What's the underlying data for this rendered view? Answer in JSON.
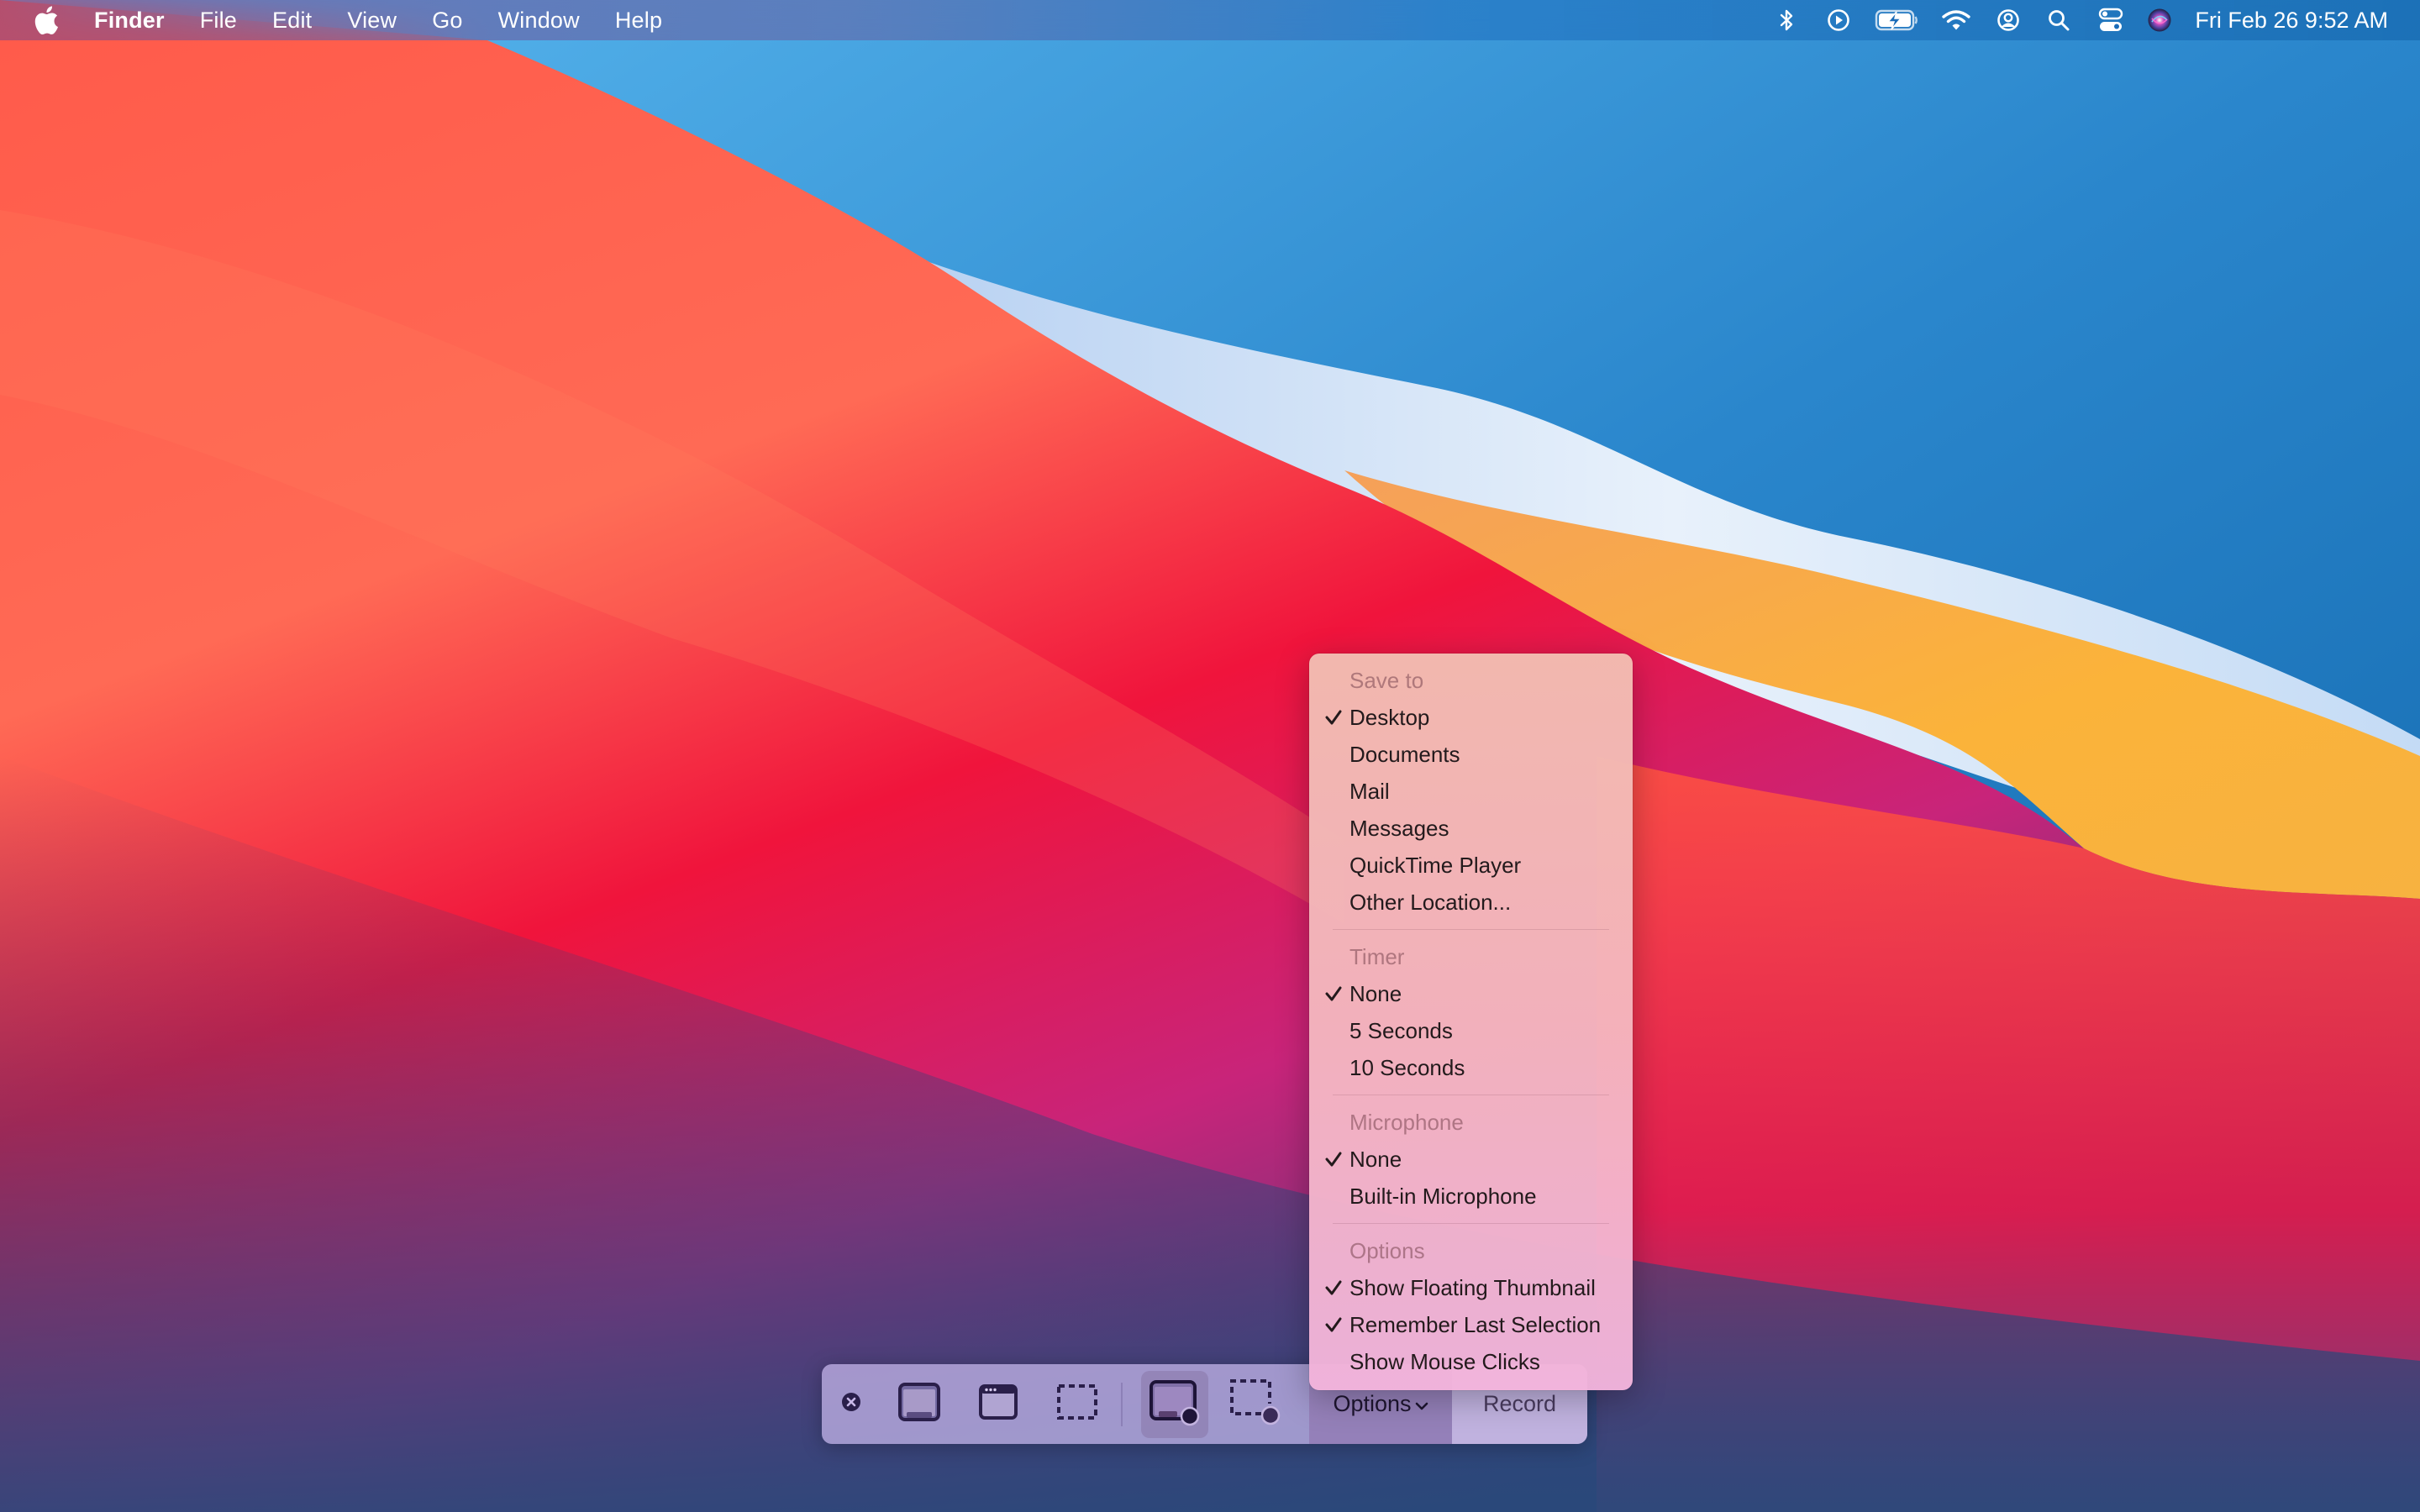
{
  "menubar": {
    "apple_icon": "apple-logo-icon",
    "app_name": "Finder",
    "menus": [
      "File",
      "Edit",
      "View",
      "Go",
      "Window",
      "Help"
    ],
    "status_icons": [
      "bluetooth-icon",
      "screen-recording-icon",
      "battery-charging-icon",
      "wifi-icon",
      "user-account-icon",
      "spotlight-search-icon",
      "control-center-icon",
      "siri-icon"
    ],
    "clock": "Fri Feb 26  9:52 AM"
  },
  "options_menu": {
    "sections": [
      {
        "title": "Save to",
        "items": [
          {
            "label": "Desktop",
            "checked": true
          },
          {
            "label": "Documents",
            "checked": false
          },
          {
            "label": "Mail",
            "checked": false
          },
          {
            "label": "Messages",
            "checked": false
          },
          {
            "label": "QuickTime Player",
            "checked": false
          },
          {
            "label": "Other Location...",
            "checked": false
          }
        ]
      },
      {
        "title": "Timer",
        "items": [
          {
            "label": "None",
            "checked": true
          },
          {
            "label": "5 Seconds",
            "checked": false
          },
          {
            "label": "10 Seconds",
            "checked": false
          }
        ]
      },
      {
        "title": "Microphone",
        "items": [
          {
            "label": "None",
            "checked": true
          },
          {
            "label": "Built-in Microphone",
            "checked": false
          }
        ]
      },
      {
        "title": "Options",
        "items": [
          {
            "label": "Show Floating Thumbnail",
            "checked": true
          },
          {
            "label": "Remember Last Selection",
            "checked": true
          },
          {
            "label": "Show Mouse Clicks",
            "checked": false
          }
        ]
      }
    ]
  },
  "toolbar": {
    "close_icon": "close-circle-icon",
    "capture_entire_screen_icon": "capture-entire-screen-icon",
    "capture_window_icon": "capture-window-icon",
    "capture_selection_icon": "capture-selection-icon",
    "record_entire_screen_icon": "record-entire-screen-icon",
    "record_selection_icon": "record-selection-icon",
    "selected_mode": "record-entire-screen",
    "options_label": "Options",
    "record_label": "Record"
  },
  "colors": {
    "menu_text": "#231a1c",
    "menu_section_title": "#a7848a",
    "toolbar_icon": "#2a1f4a"
  }
}
